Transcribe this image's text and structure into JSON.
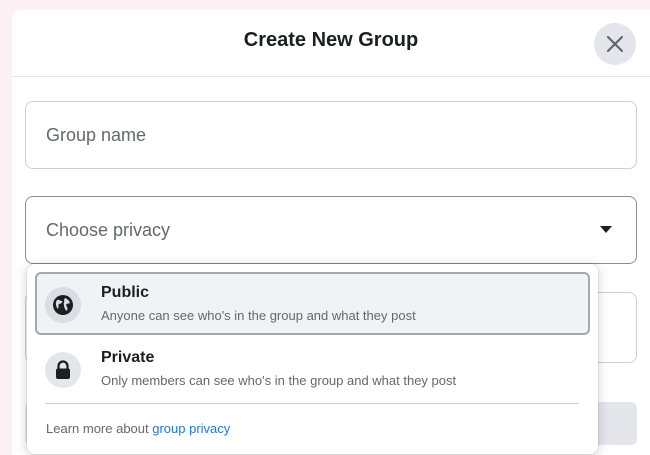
{
  "dialog": {
    "title": "Create New Group"
  },
  "form": {
    "group_name_placeholder": "Group name",
    "privacy_placeholder": "Choose privacy"
  },
  "privacy_menu": {
    "options": [
      {
        "label": "Public",
        "description": "Anyone can see who's in the group and what they post",
        "icon": "globe-icon",
        "highlighted": true
      },
      {
        "label": "Private",
        "description": "Only members can see who's in the group and what they post",
        "icon": "lock-icon",
        "highlighted": false
      }
    ],
    "learn_more_prefix": "Learn more about ",
    "learn_more_link": "group privacy"
  },
  "colors": {
    "link": "#1877f2",
    "page_background": "#fcf0f6"
  }
}
